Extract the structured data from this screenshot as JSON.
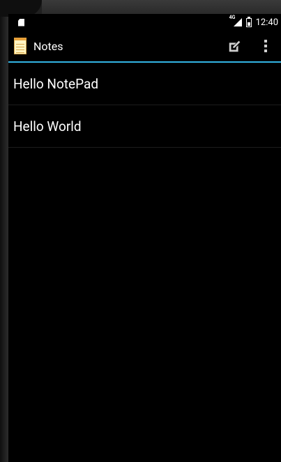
{
  "status_bar": {
    "network_label": "4G",
    "time": "12:40"
  },
  "action_bar": {
    "title": "Notes",
    "accent_color": "#33b5e5",
    "icons": [
      "notepad-app-icon",
      "new-note-icon",
      "overflow-menu-icon"
    ]
  },
  "notes": [
    {
      "title": "Hello NotePad"
    },
    {
      "title": "Hello World"
    }
  ]
}
